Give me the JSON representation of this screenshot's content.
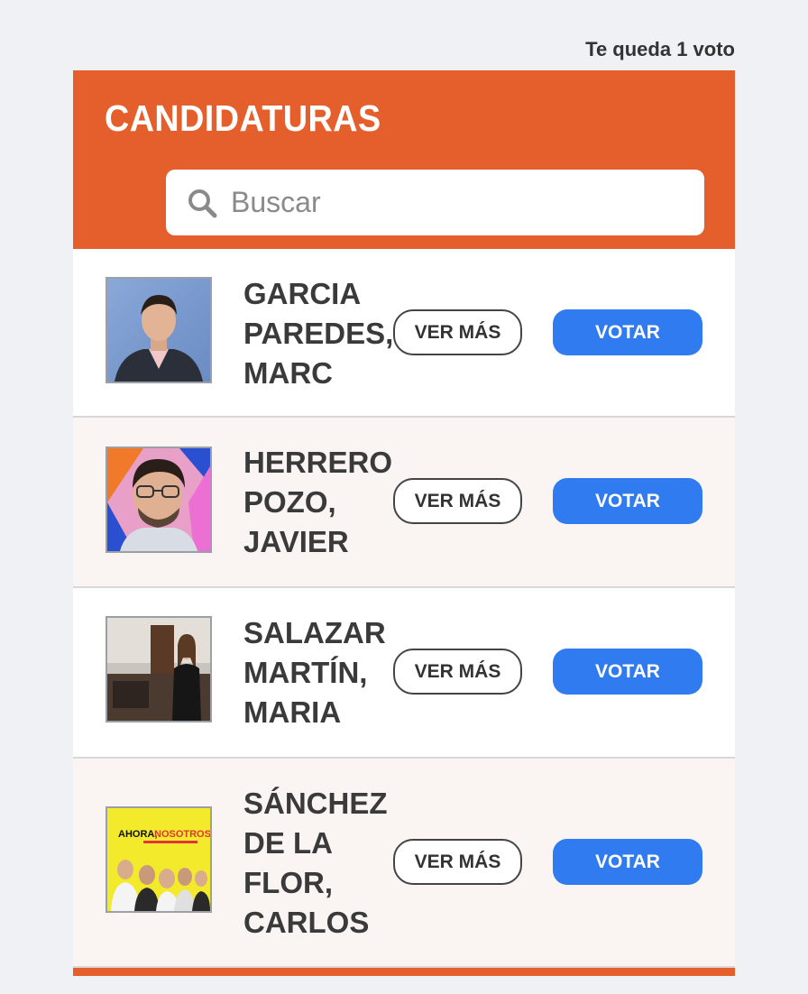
{
  "votes_remaining": "Te queda 1 voto",
  "header": {
    "title": "CANDIDATURAS",
    "color": "#e45f2b"
  },
  "search": {
    "placeholder": "Buscar",
    "icon": "search-icon"
  },
  "candidates": [
    {
      "name": "GARCIA\nPAREDES,\nMARC",
      "more_label": "VER MÁS",
      "vote_label": "VOTAR"
    },
    {
      "name": "HERRERO\nPOZO,\nJAVIER",
      "more_label": "VER MÁS",
      "vote_label": "VOTAR"
    },
    {
      "name": "SALAZAR\nMARTÍN,\nMARIA",
      "more_label": "VER MÁS",
      "vote_label": "VOTAR"
    },
    {
      "name": "SÁNCHEZ\nDE LA\nFLOR,\nCARLOS",
      "more_label": "VER MÁS",
      "vote_label": "VOTAR",
      "photo_text": {
        "line1_a": "AHORA,",
        "line1_b": "NOSOTROS"
      }
    }
  ],
  "colors": {
    "vote_button": "#2f7bef",
    "alt_row": "#faf5f3",
    "background": "#eff1f5"
  }
}
